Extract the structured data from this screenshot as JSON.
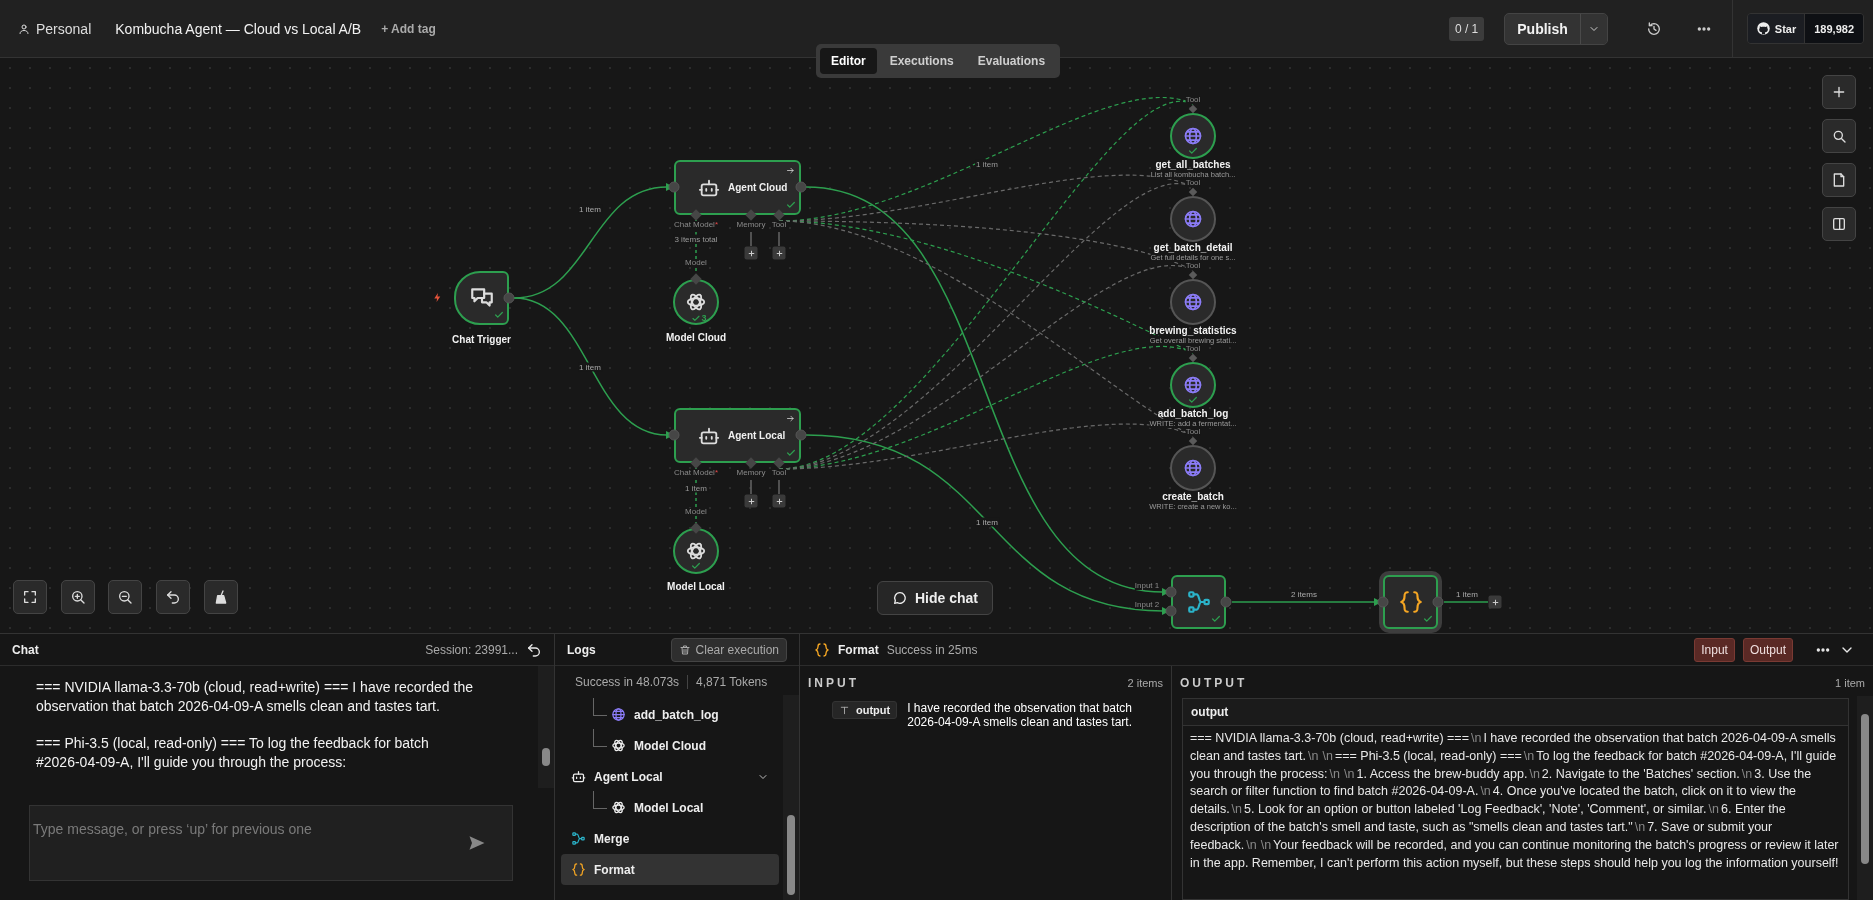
{
  "header": {
    "breadcrumb": "Personal",
    "workflow_title": "Kombucha Agent — Cloud vs Local A/B",
    "add_tag": "+ Add tag",
    "counter": "0 / 1",
    "publish": "Publish",
    "github": {
      "label": "Star",
      "count": "189,982"
    }
  },
  "view_tabs": [
    {
      "label": "Editor",
      "selected": true
    },
    {
      "label": "Executions",
      "selected": false
    },
    {
      "label": "Evaluations",
      "selected": false
    }
  ],
  "canvas": {
    "nodes": [
      {
        "kind": "trigger",
        "label": "Chat Trigger",
        "success": true
      },
      {
        "kind": "agent",
        "label": "Agent Cloud",
        "success": true,
        "handles": [
          {
            "label": "Chat Model",
            "required_mark": "*",
            "empty": false
          },
          {
            "label": "Memory",
            "empty": true
          },
          {
            "label": "Tool",
            "empty": true
          }
        ]
      },
      {
        "kind": "model",
        "label": "Model Cloud",
        "success": true,
        "handle_label": "Model",
        "run_count": "3",
        "link_label": "3 items total"
      },
      {
        "kind": "agent",
        "label": "Agent Local",
        "success": true,
        "handles": [
          {
            "label": "Chat Model",
            "required_mark": "*",
            "empty": false
          },
          {
            "label": "Memory",
            "empty": true
          },
          {
            "label": "Tool",
            "empty": true
          }
        ]
      },
      {
        "kind": "model",
        "label": "Model Local",
        "success": true,
        "handle_label": "Model",
        "link_label": "1 item"
      },
      {
        "kind": "tool",
        "label": "get_all_batches",
        "description": "List all kombucha batch...",
        "handle_label": "Tool",
        "success": true,
        "link_label": "1 item"
      },
      {
        "kind": "tool",
        "label": "get_batch_detail",
        "description": "Get full details for one s...",
        "handle_label": "Tool",
        "success": false
      },
      {
        "kind": "tool",
        "label": "brewing_statistics",
        "description": "Get overall brewing stati...",
        "handle_label": "Tool",
        "success": false
      },
      {
        "kind": "tool",
        "label": "add_batch_log",
        "description": "WRITE: add a fermentat...",
        "handle_label": "Tool",
        "success": true
      },
      {
        "kind": "tool",
        "label": "create_batch",
        "description": "WRITE: create a new ko...",
        "handle_label": "Tool",
        "success": false
      },
      {
        "kind": "merge",
        "success": true,
        "inputs": [
          "Input 1",
          "Input 2"
        ]
      },
      {
        "kind": "code",
        "success": true,
        "selected": true
      }
    ],
    "connections": [
      {
        "kind": "main",
        "active": true,
        "label": "1 item"
      },
      {
        "kind": "main",
        "active": true,
        "label": "1 item"
      },
      {
        "kind": "main",
        "active": true
      },
      {
        "kind": "main",
        "active": true,
        "label": "1 item"
      },
      {
        "kind": "main",
        "active": true,
        "label": "2 items"
      },
      {
        "kind": "main",
        "active": true,
        "label": "1 item"
      }
    ],
    "hide_chat": "Hide chat"
  },
  "chat": {
    "title": "Chat",
    "session": "Session: 23991...",
    "messages": [
      "=== NVIDIA llama-3.3-70b (cloud, read+write) === I have recorded the observation that batch 2026-04-09-A smells clean and tastes tart.",
      "=== Phi-3.5 (local, read-only) === To log the feedback for batch #2026-04-09-A, I'll guide you through the process:"
    ],
    "input": {
      "placeholder": "Type message, or press ‘up’ for previous one"
    }
  },
  "logs": {
    "title": "Logs",
    "clear_button": "Clear execution",
    "status": "Success in 48.073s",
    "tokens": "4,871 Tokens",
    "entries": [
      {
        "kind": "continued",
        "children": [
          {
            "kind": "tool",
            "label": "add_batch_log",
            "selected": false
          },
          {
            "kind": "model",
            "label": "Model Cloud",
            "selected": false
          }
        ]
      },
      {
        "kind": "agent",
        "label": "Agent Local",
        "selected": false,
        "expanded": true,
        "children": [
          {
            "kind": "model",
            "label": "Model Local",
            "selected": false
          }
        ]
      },
      {
        "kind": "merge",
        "label": "Merge",
        "selected": false
      },
      {
        "kind": "code",
        "label": "Format",
        "selected": true
      }
    ]
  },
  "format_panel": {
    "title": "Format",
    "status": "Success in 25ms",
    "buttons": [
      "Input",
      "Output"
    ],
    "input": {
      "heading": "INPUT",
      "count": "2 items",
      "field": "output",
      "value": "I have recorded the observation that batch 2026-04-09-A smells clean and tastes tart."
    },
    "output": {
      "heading": "OUTPUT",
      "count": "1 item",
      "column": "output",
      "value": [
        {
          "kind": "text",
          "text": "=== NVIDIA llama-3.3-70b (cloud, read+write) ==="
        },
        {
          "kind": "escape",
          "text": "\\n"
        },
        {
          "kind": "text",
          "text": "I have recorded the observation that batch 2026-04-09-A smells clean and tastes tart."
        },
        {
          "kind": "escape",
          "text": "\\n"
        },
        {
          "kind": "escape",
          "text": "\\n"
        },
        {
          "kind": "text",
          "text": "=== Phi-3.5 (local, read-only) ==="
        },
        {
          "kind": "escape",
          "text": "\\n"
        },
        {
          "kind": "text",
          "text": "To log the feedback for batch #2026-04-09-A, I'll guide you through the process:"
        },
        {
          "kind": "escape",
          "text": "\\n"
        },
        {
          "kind": "escape",
          "text": "\\n"
        },
        {
          "kind": "text",
          "text": "1. Access the brew-buddy app."
        },
        {
          "kind": "escape",
          "text": "\\n"
        },
        {
          "kind": "text",
          "text": "2. Navigate to the 'Batches' section."
        },
        {
          "kind": "escape",
          "text": "\\n"
        },
        {
          "kind": "text",
          "text": "3. Use the search or filter function to find batch #2026-04-09-A."
        },
        {
          "kind": "escape",
          "text": "\\n"
        },
        {
          "kind": "text",
          "text": "4. Once you've located the batch, click on it to view the details."
        },
        {
          "kind": "escape",
          "text": "\\n"
        },
        {
          "kind": "text",
          "text": "5. Look for an option or button labeled 'Log Feedback', 'Note', 'Comment', or similar."
        },
        {
          "kind": "escape",
          "text": "\\n"
        },
        {
          "kind": "text",
          "text": "6. Enter the description of the batch's smell and taste, such as \"smells clean and tastes tart.\""
        },
        {
          "kind": "escape",
          "text": "\\n"
        },
        {
          "kind": "text",
          "text": "7. Save or submit your feedback."
        },
        {
          "kind": "escape",
          "text": "\\n"
        },
        {
          "kind": "escape",
          "text": "\\n"
        },
        {
          "kind": "text",
          "text": "Your feedback will be recorded, and you can continue monitoring the batch's progress or review it later in the app. Remember, I can't perform this action myself, but these steps should help you log the information yourself!"
        }
      ]
    }
  }
}
